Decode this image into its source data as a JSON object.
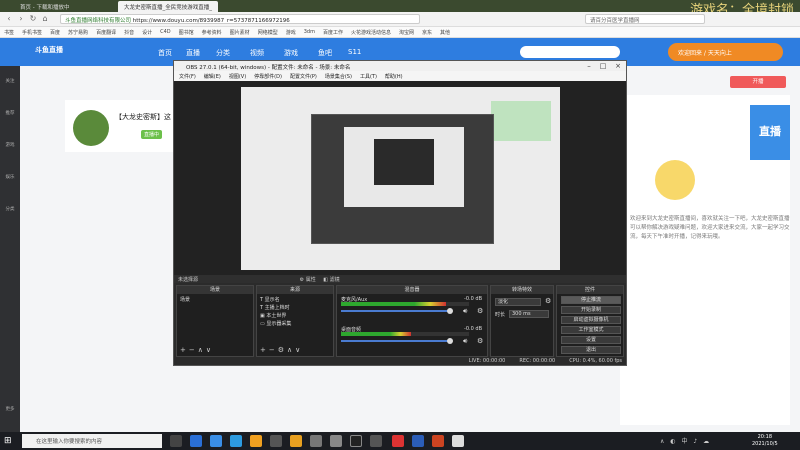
{
  "browser": {
    "tabs": [
      {
        "label": "首页 - 下载和播放中",
        "active": false
      },
      {
        "label": "大龙史密斯直播_全民竞技游戏直播_",
        "active": true
      }
    ],
    "watermark": "游戏名：全境封锁",
    "url_site": "斗鱼直播网络科技有限公司",
    "url": "https://www.douyu.com/8939987_r=5737871166972196",
    "search_placeholder": "请百分百医学直播网",
    "bookmarks": [
      "书签",
      "手机书签",
      "百度",
      "苏宁易购",
      "百度翻译",
      "抖音",
      "设计",
      "C4D",
      "图书馆",
      "参考资料",
      "图片素材",
      "网络模型",
      "游戏",
      "3dm",
      "百度工作",
      "火花游戏活动信息",
      "淘宝网",
      "京东",
      "其他"
    ]
  },
  "site": {
    "logo": "斗鱼直播",
    "nav": [
      "首页",
      "直播",
      "分类",
      "视频",
      "游戏",
      "鱼吧",
      "S11"
    ],
    "promo": "欢迎回来 / 天天向上",
    "red_button": "开播",
    "room_title": "【大龙史密斯】这",
    "rec_badge": "直播中",
    "chat_text": "欢迎来到大龙史密斯直播间，喜欢就关注一下吧，大龙史密斯直播可以帮你解决游戏疑难问题，欢迎大家进来交流，大家一起学习交流，每天下午准时开播，记得来玩哦。",
    "blue_box": "直播",
    "rail": [
      "关注",
      "推荐",
      "游戏",
      "娱乐",
      "分类",
      "更多"
    ]
  },
  "obs": {
    "title": "OBS 27.0.1 (64-bit, windows) - 配置文件: 未命名 - 场景: 未命名",
    "menu": [
      "文件(F)",
      "编辑(E)",
      "视图(V)",
      "停靠部件(D)",
      "配置文件(P)",
      "场景集合(S)",
      "工具(T)",
      "帮助(H)"
    ],
    "status_line": "未选择源",
    "status_props": "属性",
    "status_filters": "滤镜",
    "docks": {
      "scenes": {
        "title": "场景",
        "items": [
          "场景"
        ]
      },
      "sources": {
        "title": "来源",
        "items": [
          "显示名",
          "主播上档时",
          "本土世界",
          "显示器采集"
        ]
      },
      "mixer": {
        "title": "混音器",
        "channels": [
          {
            "name": "麦克风/Aux",
            "db": "-0.0 dB",
            "level": 0.82
          },
          {
            "name": "桌面音频",
            "db": "-0.0 dB",
            "level": 0.55
          }
        ]
      },
      "transitions": {
        "title": "转场特效",
        "type": "淡化",
        "duration_label": "时长",
        "duration": "300 ms"
      },
      "controls": {
        "title": "控件",
        "buttons": [
          "停止推流",
          "开始录制",
          "启动虚拟摄像机",
          "工作室模式",
          "设置",
          "退出"
        ]
      }
    },
    "statusbar": {
      "live": "LIVE: 00:00:00",
      "rec": "REC: 00:00:00",
      "cpu": "CPU: 0.4%, 60.00 fps"
    }
  },
  "taskbar": {
    "search": "在这里输入你要搜索的内容",
    "time": "20:18",
    "date": "2021/10/5",
    "tray": "∧ ◐ 中 ♪ ☁"
  }
}
